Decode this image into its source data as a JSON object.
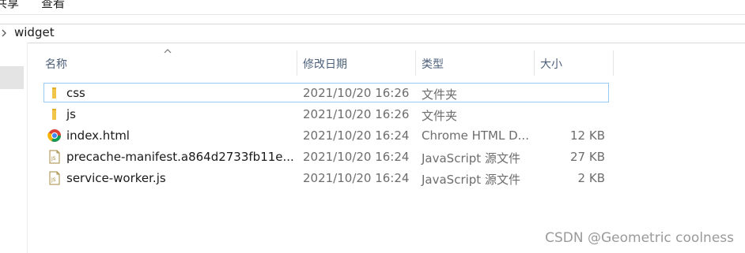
{
  "ribbon": {
    "tabs": [
      "共享",
      "查看"
    ]
  },
  "address_bar": {
    "chevron_icon": "chevron-right-icon",
    "path": "widget"
  },
  "columns": {
    "name": "名称",
    "date_modified": "修改日期",
    "type": "类型",
    "size": "大小"
  },
  "files": [
    {
      "icon": "folder-icon",
      "name": "css",
      "date": "2021/10/20 16:26",
      "type": "文件夹",
      "size": "",
      "selected": true
    },
    {
      "icon": "folder-icon",
      "name": "js",
      "date": "2021/10/20 16:26",
      "type": "文件夹",
      "size": "",
      "selected": false
    },
    {
      "icon": "chrome-html-icon",
      "name": "index.html",
      "date": "2021/10/20 16:24",
      "type": "Chrome HTML D...",
      "size": "12 KB",
      "selected": false
    },
    {
      "icon": "js-file-icon",
      "name": "precache-manifest.a864d2733fb11e...",
      "date": "2021/10/20 16:24",
      "type": "JavaScript 源文件",
      "size": "27 KB",
      "selected": false
    },
    {
      "icon": "js-file-icon",
      "name": "service-worker.js",
      "date": "2021/10/20 16:24",
      "type": "JavaScript 源文件",
      "size": "2 KB",
      "selected": false
    }
  ],
  "colors": {
    "header_text": "#4c607a",
    "selection_border": "#99c9ef",
    "folder": "#f0c54a",
    "secondary_text": "#6d6d6d"
  },
  "watermark": "CSDN @Geometric coolness"
}
